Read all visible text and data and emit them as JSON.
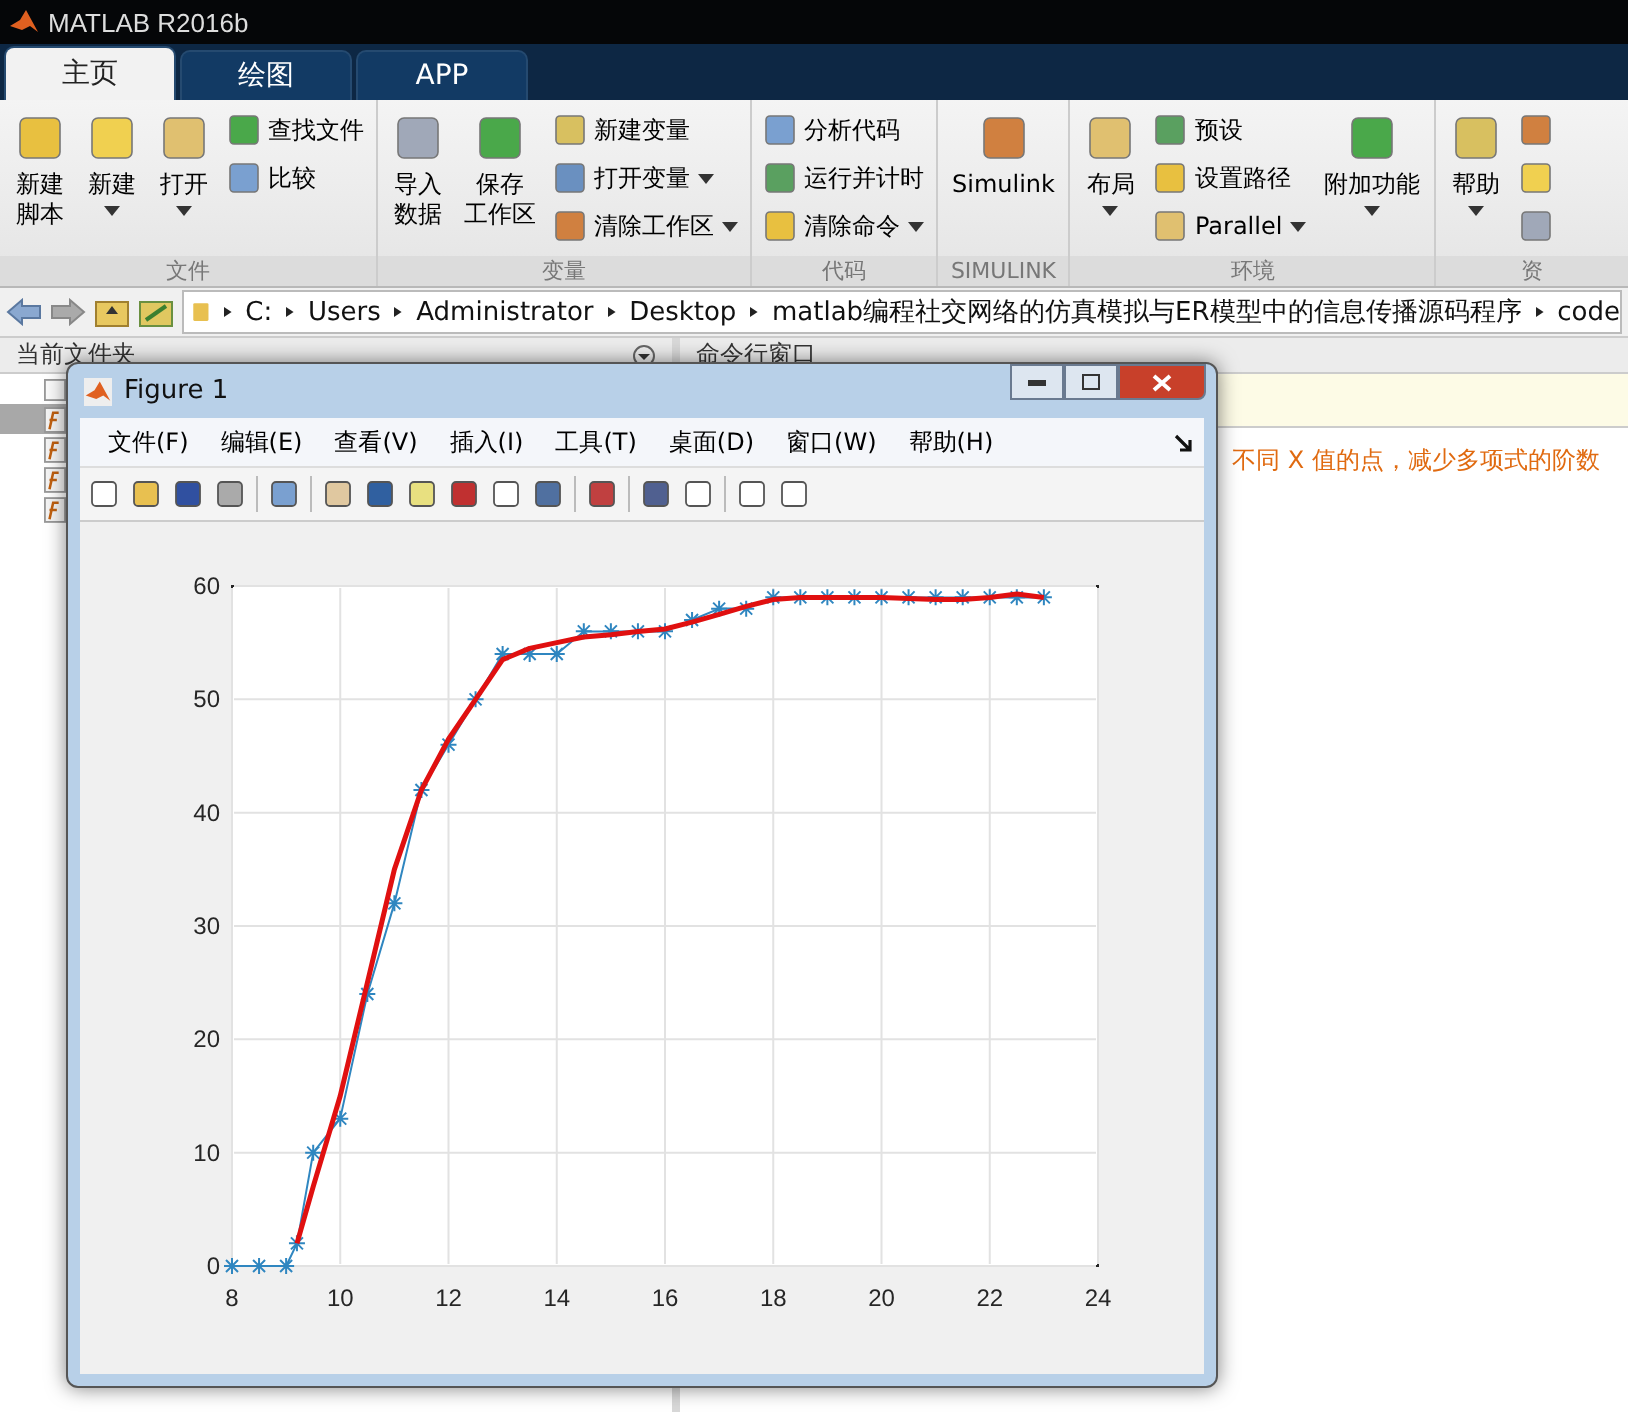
{
  "window": {
    "title": "MATLAB R2016b"
  },
  "tabs": [
    {
      "label": "主页",
      "selected": true
    },
    {
      "label": "绘图",
      "selected": false
    },
    {
      "label": "APP",
      "selected": false
    }
  ],
  "ribbon": [
    {
      "label": "文件",
      "columns": [
        {
          "kind": "large",
          "lines": [
            "新建",
            "脚本"
          ],
          "dropdown": false
        },
        {
          "kind": "large",
          "lines": [
            "新建"
          ],
          "dropdown": true
        },
        {
          "kind": "large",
          "lines": [
            "打开"
          ],
          "dropdown": true
        },
        {
          "kind": "stack",
          "items": [
            {
              "label": "查找文件",
              "dropdown": false
            },
            {
              "label": "比较",
              "dropdown": false
            }
          ]
        }
      ]
    },
    {
      "label": "变量",
      "columns": [
        {
          "kind": "large",
          "lines": [
            "导入",
            "数据"
          ],
          "dropdown": false
        },
        {
          "kind": "large",
          "lines": [
            "保存",
            "工作区"
          ],
          "dropdown": false
        },
        {
          "kind": "stack",
          "items": [
            {
              "label": "新建变量",
              "dropdown": false
            },
            {
              "label": "打开变量",
              "dropdown": true
            },
            {
              "label": "清除工作区",
              "dropdown": true
            }
          ]
        }
      ]
    },
    {
      "label": "代码",
      "columns": [
        {
          "kind": "stack",
          "items": [
            {
              "label": "分析代码",
              "dropdown": false
            },
            {
              "label": "运行并计时",
              "dropdown": false
            },
            {
              "label": "清除命令",
              "dropdown": true
            }
          ]
        }
      ]
    },
    {
      "label": "SIMULINK",
      "columns": [
        {
          "kind": "large",
          "lines": [
            "Simulink"
          ],
          "dropdown": false
        }
      ]
    },
    {
      "label": "环境",
      "columns": [
        {
          "kind": "large",
          "lines": [
            "布局"
          ],
          "dropdown": true
        },
        {
          "kind": "stack",
          "items": [
            {
              "label": "预设",
              "dropdown": false
            },
            {
              "label": "设置路径",
              "dropdown": false
            },
            {
              "label": "Parallel",
              "dropdown": true
            }
          ]
        },
        {
          "kind": "large",
          "lines": [
            "附加功能"
          ],
          "dropdown": true
        }
      ]
    },
    {
      "label": "资",
      "columns": [
        {
          "kind": "large",
          "lines": [
            "帮助"
          ],
          "dropdown": true
        },
        {
          "kind": "stack",
          "items": [
            {
              "dropdown": false
            },
            {
              "dropdown": false
            },
            {
              "dropdown": false
            }
          ]
        }
      ]
    }
  ],
  "address_bar": {
    "segments": [
      "C:",
      "Users",
      "Administrator",
      "Desktop",
      "matlab编程社交网络的仿真模拟与ER模型中的信息传播源码程序",
      "code"
    ]
  },
  "current_folder": {
    "title": "当前文件夹",
    "rows": [
      {
        "kind": "header",
        "selected": false
      },
      {
        "kind": "function",
        "selected": true
      },
      {
        "kind": "function",
        "selected": false
      },
      {
        "kind": "function",
        "selected": false
      },
      {
        "kind": "function",
        "selected": false
      }
    ]
  },
  "command_window": {
    "title": "命令行窗口",
    "warning": "不同 X 值的点，减少多项式的阶数"
  },
  "figure": {
    "title": "Figure 1",
    "menu": [
      "文件(F)",
      "编辑(E)",
      "查看(V)",
      "插入(I)",
      "工具(T)",
      "桌面(D)",
      "窗口(W)",
      "帮助(H)"
    ],
    "chart_data": {
      "type": "line",
      "grid": true,
      "x": [
        8,
        8.5,
        9,
        9.2,
        9.5,
        10,
        10.5,
        11,
        11.5,
        12,
        12.5,
        13,
        13.5,
        14,
        14.5,
        15,
        15.5,
        16,
        16.5,
        17,
        17.5,
        18,
        18.5,
        19,
        19.5,
        20,
        20.5,
        21,
        21.5,
        22,
        22.5,
        23
      ],
      "series": [
        {
          "color": "#2f86c0",
          "marker": "cross",
          "values": [
            0,
            0,
            0,
            2,
            10,
            13,
            24,
            32,
            42,
            46,
            50,
            54,
            54,
            54,
            56,
            56,
            56,
            56,
            57,
            58,
            58,
            59,
            59,
            59,
            59,
            59,
            59,
            59,
            59,
            59,
            59,
            59
          ]
        },
        {
          "color": "#e01010",
          "values": [
            null,
            null,
            null,
            2,
            7,
            15,
            25,
            35,
            42,
            46.5,
            50,
            53.5,
            54.5,
            55,
            55.5,
            55.7,
            56,
            56.2,
            56.8,
            57.5,
            58.2,
            58.8,
            59,
            59,
            59,
            59,
            58.9,
            58.8,
            58.8,
            59,
            59.3,
            59
          ]
        }
      ],
      "xlim": [
        8,
        24
      ],
      "ylim": [
        0,
        60
      ],
      "xticks": [
        8,
        10,
        12,
        14,
        16,
        18,
        20,
        22,
        24
      ],
      "yticks": [
        0,
        10,
        20,
        30,
        40,
        50,
        60
      ]
    }
  }
}
